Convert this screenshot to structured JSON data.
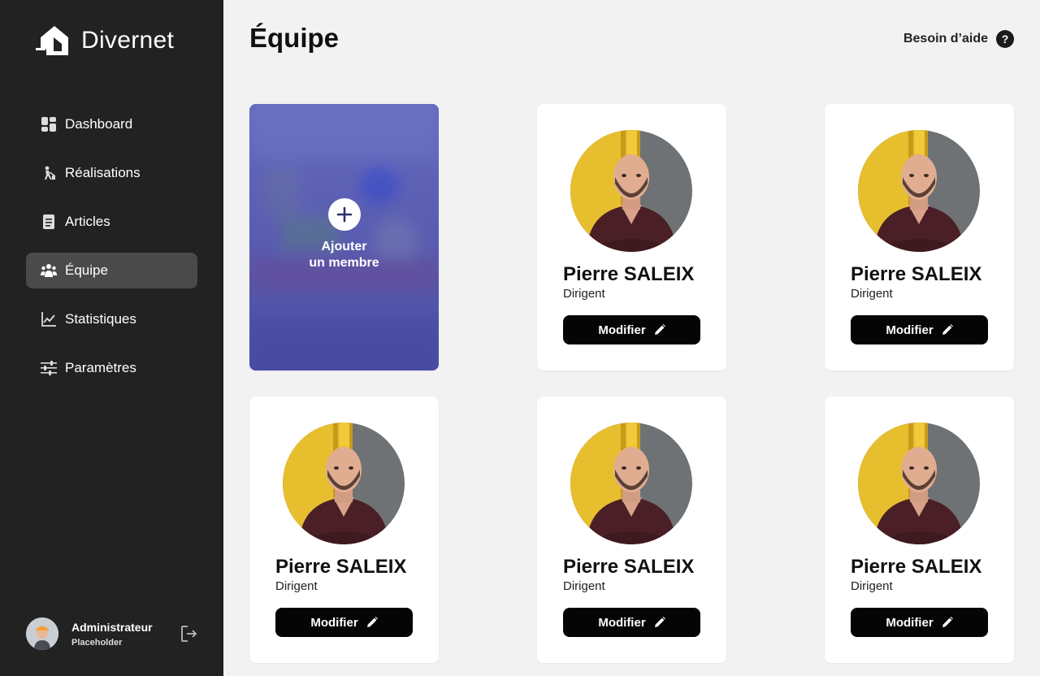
{
  "brand": {
    "name": "Divernet",
    "icon": "house-logo-icon"
  },
  "sidebar": {
    "items": [
      {
        "label": "Dashboard",
        "icon": "dashboard-icon",
        "active": false
      },
      {
        "label": "Réalisations",
        "icon": "worker-icon",
        "active": false
      },
      {
        "label": "Articles",
        "icon": "document-icon",
        "active": false
      },
      {
        "label": "Équipe",
        "icon": "team-icon",
        "active": true
      },
      {
        "label": "Statistiques",
        "icon": "chart-line-icon",
        "active": false
      },
      {
        "label": "Paramètres",
        "icon": "sliders-icon",
        "active": false
      }
    ],
    "profile": {
      "name": "Administrateur",
      "role": "Placeholder"
    }
  },
  "header": {
    "title": "Équipe",
    "help_label": "Besoin d’aide",
    "help_icon": "?"
  },
  "add_card": {
    "line1": "Ajouter",
    "line2": "un membre"
  },
  "members": [
    {
      "name": "Pierre SALEIX",
      "role": "Dirigent",
      "button": "Modifier"
    },
    {
      "name": "Pierre SALEIX",
      "role": "Dirigent",
      "button": "Modifier"
    },
    {
      "name": "Pierre SALEIX",
      "role": "Dirigent",
      "button": "Modifier"
    },
    {
      "name": "Pierre SALEIX",
      "role": "Dirigent",
      "button": "Modifier"
    },
    {
      "name": "Pierre SALEIX",
      "role": "Dirigent",
      "button": "Modifier"
    }
  ],
  "colors": {
    "sidebar_bg": "#222222",
    "active_item": "#4a4a4a",
    "page_bg": "#f2f2f2",
    "button_bg": "#050505",
    "add_card_tint": "#5557a8"
  }
}
